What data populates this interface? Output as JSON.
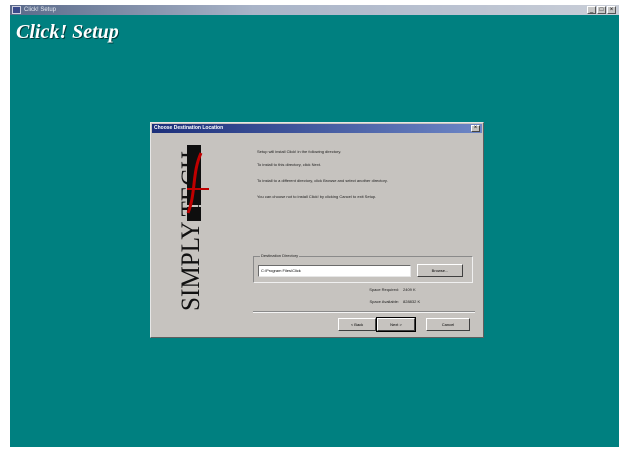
{
  "window": {
    "title": "Click! Setup",
    "controls": [
      "_",
      "□",
      "×"
    ]
  },
  "brand_title": "Click! Setup",
  "dialog": {
    "title": "Choose Destination Location",
    "close_label": "×",
    "logo_text": "SIMPLY TECH",
    "lines": [
      "Setup will install Click! in the following directory.",
      "To install to this directory, click Next.",
      "To install to a different directory, click Browse and select another directory.",
      "You can choose not to install Click! by clicking Cancel to exit Setup."
    ],
    "destination_label": "Destination Directory",
    "destination_path": "C:\\Program Files\\Click",
    "browse_label": "Browse...",
    "space_required_label": "Space Required:",
    "space_required_value": "2409 K",
    "space_available_label": "Space Available:",
    "space_available_value": "828832 K",
    "back_label": "< Back",
    "next_label": "Next >",
    "cancel_label": "Cancel"
  },
  "colors": {
    "desktop": "#008080",
    "dialog_bg": "#c6c3bf",
    "title_active": "#1c2f7a",
    "logo_red": "#c00000"
  }
}
